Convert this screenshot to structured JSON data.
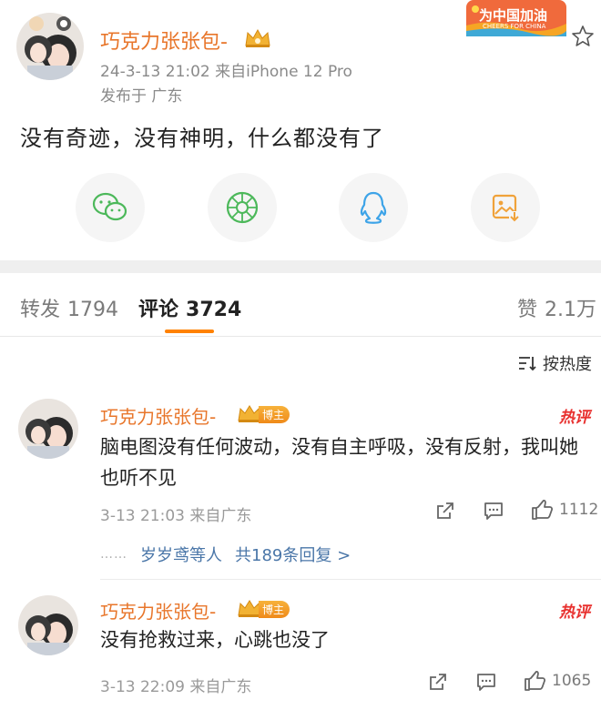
{
  "post": {
    "author": "巧克力张张包-",
    "meta": "24-3-13 21:02  来自iPhone 12 Pro",
    "location": "发布于 广东",
    "banner_text": "为中国加油",
    "banner_subtext": "CHEERS FOR CHINA",
    "text": "没有奇迹，没有神明，什么都没有了",
    "share_icons": [
      "wechat-icon",
      "moments-icon",
      "qq-icon",
      "save-image-icon"
    ]
  },
  "stats": {
    "repost_label": "转发",
    "repost_count": "1794",
    "comment_label": "评论",
    "comment_count": "3724",
    "like_label": "赞",
    "like_count": "2.1万"
  },
  "sort": {
    "label": "按热度"
  },
  "comments": [
    {
      "author": "巧克力张张包-",
      "badge": "博主",
      "hot_label": "热评",
      "text": "脑电图没有任何波动，没有自主呼吸，没有反射，我叫她也听不见",
      "time": "3-13 21:03 来自广东",
      "likes": "1112",
      "replies_prefix": "……",
      "replies_users": "岁岁鸢等人",
      "replies_count": "共189条回复 >"
    },
    {
      "author": "巧克力张张包-",
      "badge": "博主",
      "hot_label": "热评",
      "text": "没有抢救过来，心跳也没了",
      "time": "3-13 22:09 来自广东",
      "likes": "1065"
    }
  ],
  "colors": {
    "accent": "#ff8200",
    "username": "#e8762b",
    "link": "#4a76a8",
    "hot": "#e8302e"
  }
}
